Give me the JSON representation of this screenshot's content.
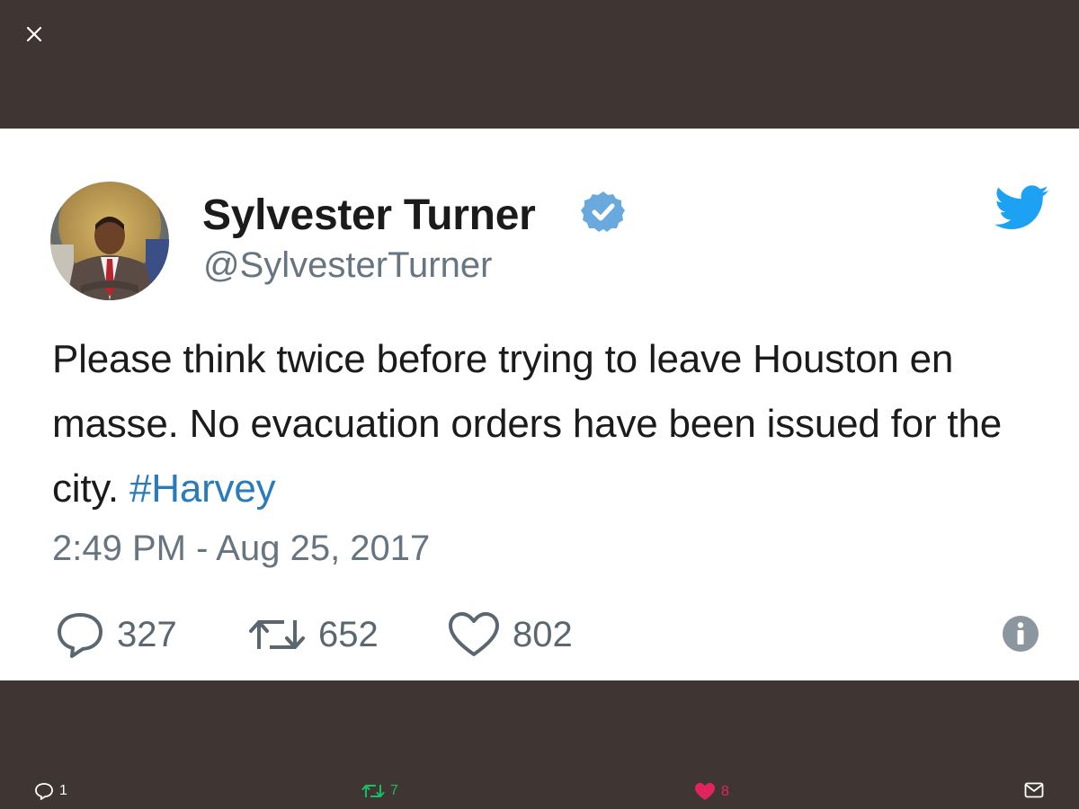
{
  "tweet": {
    "author_name": "Sylvester Turner",
    "author_handle": "@SylvesterTurner",
    "text_before_hashtag": "Please think twice before trying to leave Houston en masse. No evacuation orders have been issued for the city. ",
    "hashtag": "#Harvey",
    "timestamp": "2:49 PM - Aug 25, 2017",
    "reply_count": "327",
    "retweet_count": "652",
    "like_count": "802"
  },
  "bottom_bar": {
    "reply_count": "1",
    "retweet_count": "7",
    "like_count": "8"
  },
  "icons": {
    "close": "close-icon",
    "verified": "verified-badge-icon",
    "brand": "twitter-bird-icon",
    "reply": "reply-icon",
    "retweet": "retweet-icon",
    "like": "heart-icon",
    "info": "info-icon",
    "message": "envelope-icon"
  },
  "colors": {
    "backdrop": "#3f3533",
    "twitter_blue": "#1da1f2",
    "hashtag": "#2b7bb9",
    "retweet_green": "#17bf63",
    "like_pink": "#e0245e"
  }
}
